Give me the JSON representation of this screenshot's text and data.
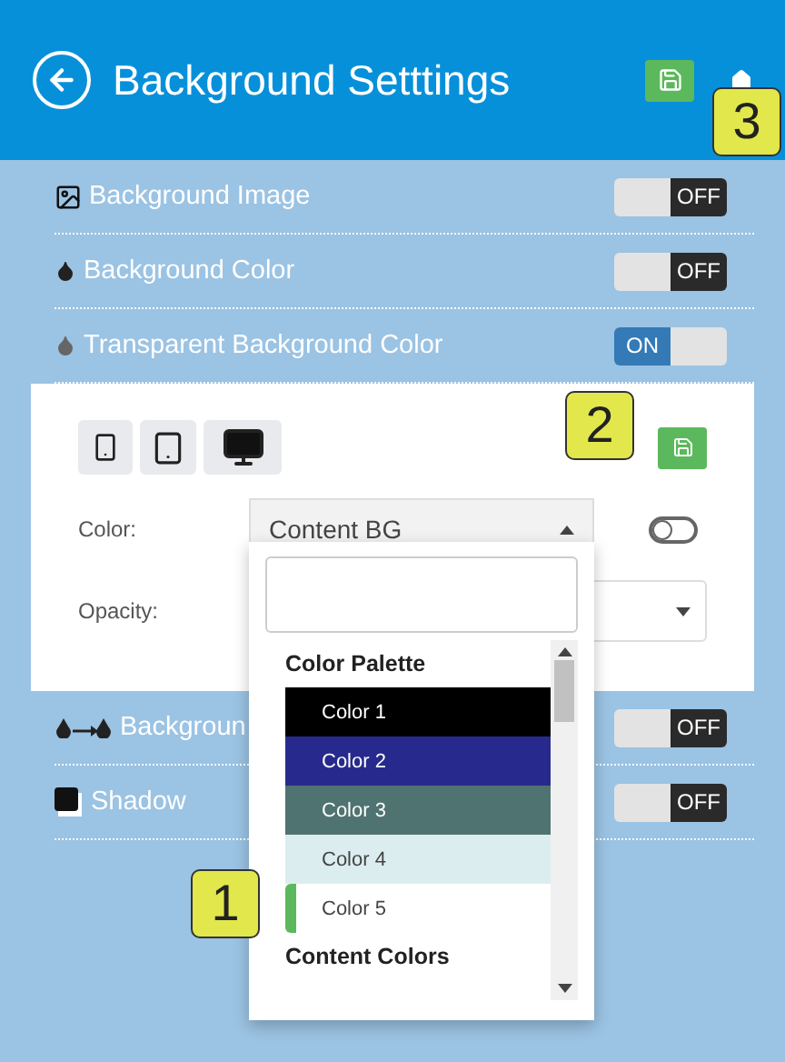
{
  "header": {
    "title": "Background Setttings"
  },
  "settings": [
    {
      "kind": "image",
      "label": "Background Image",
      "on": false,
      "toggle_text": "OFF"
    },
    {
      "kind": "drop",
      "label": "Background Color",
      "on": false,
      "toggle_text": "OFF"
    },
    {
      "kind": "drop-light",
      "label": "Transparent Background Color",
      "on": true,
      "toggle_text": "ON"
    }
  ],
  "panel": {
    "devices": [
      {
        "kind": "phone"
      },
      {
        "kind": "tablet"
      },
      {
        "kind": "desktop"
      }
    ],
    "color": {
      "label": "Color:",
      "value": "Content BG",
      "switch_on": false
    },
    "opacity": {
      "label": "Opacity:"
    }
  },
  "dropdown": {
    "groups": [
      {
        "title": "Color Palette",
        "items": [
          {
            "label": "Color 1",
            "color": "#000000",
            "selected": false
          },
          {
            "label": "Color 2",
            "color": "#272a8c",
            "selected": false
          },
          {
            "label": "Color 3",
            "color": "#4f7370",
            "selected": false
          },
          {
            "label": "Color 4",
            "color": "#dcedef",
            "selected": false
          },
          {
            "label": "Color 5",
            "color": "#ffffff",
            "selected": true
          }
        ]
      },
      {
        "title": "Content Colors"
      }
    ]
  },
  "lower_settings": [
    {
      "kind": "gradient",
      "label": "Backgroun",
      "on": false,
      "toggle_text": "OFF"
    },
    {
      "kind": "shadow",
      "label": "Shadow",
      "on": false,
      "toggle_text": "OFF"
    }
  ],
  "callouts": [
    {
      "number": "3"
    },
    {
      "number": "2"
    },
    {
      "number": "1"
    }
  ]
}
